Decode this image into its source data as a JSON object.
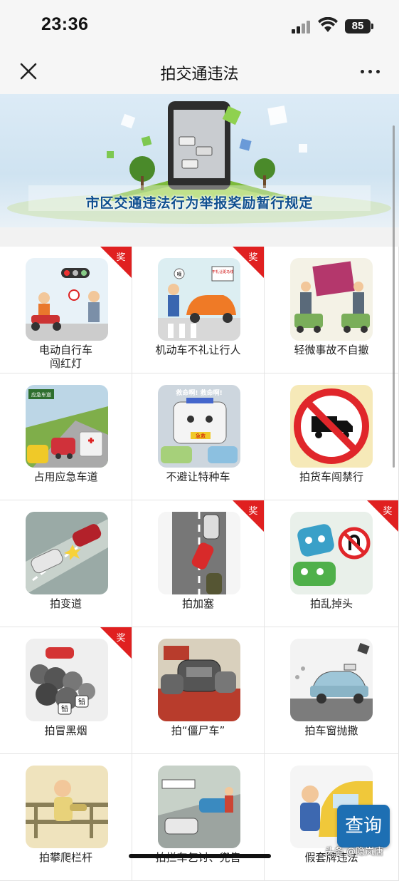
{
  "status_bar": {
    "time": "23:36",
    "battery": "85"
  },
  "header": {
    "title": "拍交通违法"
  },
  "banner": {
    "title": "市区交通违法行为举报奖励暂行规定"
  },
  "badge_text": "奖",
  "items": [
    {
      "label": "电动自行车\n闯红灯",
      "badge": true
    },
    {
      "label": "机动车不礼让行人",
      "badge": true
    },
    {
      "label": "轻微事故不自撤",
      "badge": false
    },
    {
      "label": "占用应急车道",
      "badge": false
    },
    {
      "label": "不避让特种车",
      "badge": false
    },
    {
      "label": "拍货车闯禁行",
      "badge": false
    },
    {
      "label": "拍变道",
      "badge": false
    },
    {
      "label": "拍加塞",
      "badge": true
    },
    {
      "label": "拍乱掉头",
      "badge": true
    },
    {
      "label": "拍冒黑烟",
      "badge": true
    },
    {
      "label": "拍“僵尸车”",
      "badge": false
    },
    {
      "label": "拍车窗抛撒",
      "badge": false
    },
    {
      "label": "拍攀爬栏杆",
      "badge": false
    },
    {
      "label": "拍拦车乞讨、兜售",
      "badge": false
    },
    {
      "label": "假套牌违法",
      "badge": false
    }
  ],
  "thumb_text": {
    "sign": "不礼让斑马线",
    "shout": "救命啊! 救命啊!",
    "jiuhu": "急救",
    "emergency": "应急车道",
    "bubble1": "嘀",
    "bubble2": "嘀",
    "smoke1": "铅",
    "smoke2": "铅"
  },
  "query_button": "查询",
  "watermark": "头条 @隐岚唐",
  "colors": {
    "badge_red": "#e02020",
    "accent_blue": "#1d6fb3",
    "banner_title": "#0f4f8f"
  }
}
